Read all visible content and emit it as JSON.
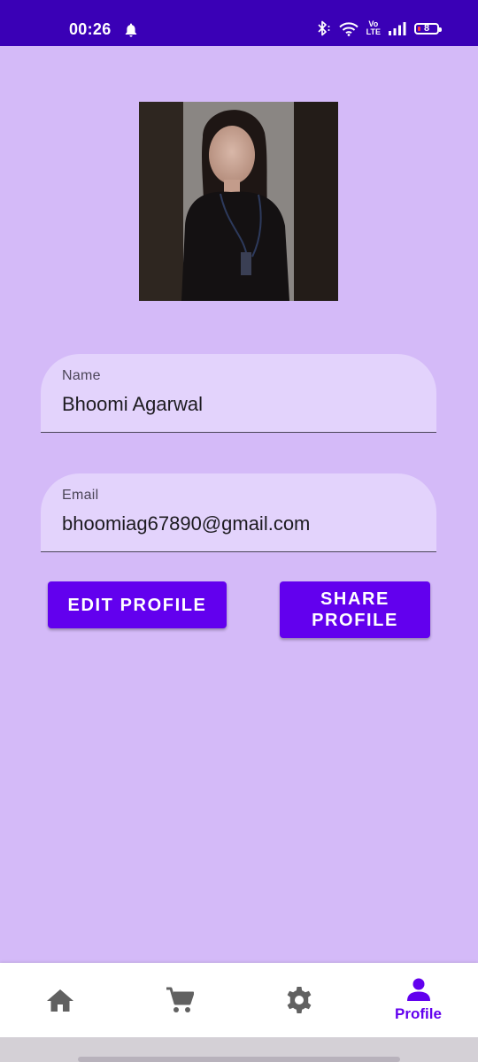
{
  "status_bar": {
    "time": "00:26",
    "volte_top": "Vo",
    "volte_bottom": "LTE",
    "battery": "8",
    "icons": [
      "bell-icon",
      "bluetooth-icon",
      "wifi-icon",
      "volte-icon",
      "signal-icon",
      "battery-icon"
    ]
  },
  "profile": {
    "photo_icon": "profile-photo",
    "name": {
      "label": "Name",
      "value": "Bhoomi Agarwal"
    },
    "email": {
      "label": "Email",
      "value": "bhoomiag67890@gmail.com"
    }
  },
  "actions": {
    "edit_label": "EDIT PROFILE",
    "share_label_line1": "SHARE",
    "share_label_line2": "PROFILE"
  },
  "bottom_nav": {
    "items": [
      {
        "icon": "home-icon",
        "label": ""
      },
      {
        "icon": "cart-icon",
        "label": ""
      },
      {
        "icon": "settings-icon",
        "label": ""
      },
      {
        "icon": "person-icon",
        "label": "Profile",
        "active": true
      }
    ]
  },
  "colors": {
    "status_bar": "#3a00b6",
    "background": "#d4baf8",
    "field_bg": "#e3d3fc",
    "accent": "#6200ee",
    "inactive_icon": "#616161"
  }
}
